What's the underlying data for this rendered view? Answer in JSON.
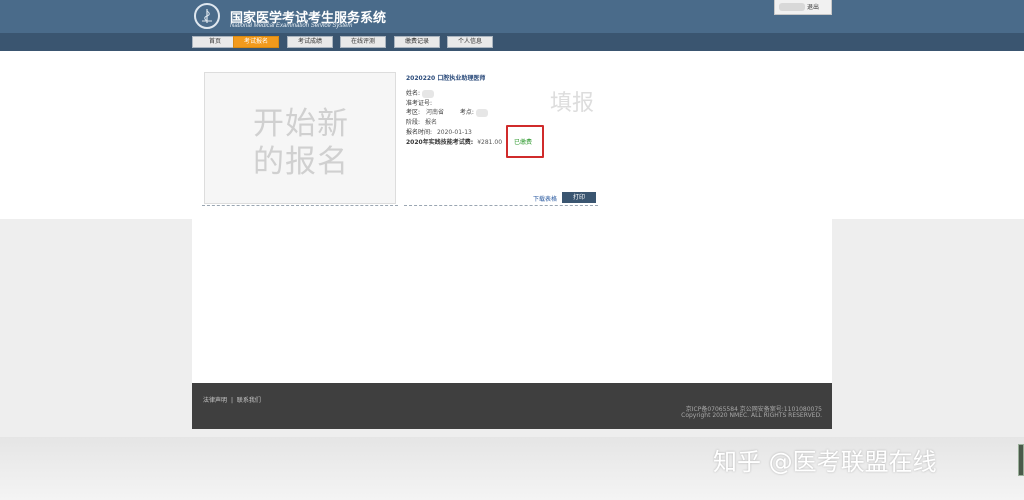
{
  "header": {
    "title": "国家医学考试考生服务系统",
    "subtitle": "National Medical Examination Service System",
    "logout_label": "退出",
    "brand_color": "#4a6b8a"
  },
  "nav": {
    "tabs": [
      {
        "label": "首页",
        "active": false
      },
      {
        "label": "考试报名",
        "active": true
      },
      {
        "label": "考试成绩",
        "active": false
      },
      {
        "label": "在线评测",
        "active": false
      },
      {
        "label": "缴费记录",
        "active": false
      },
      {
        "label": "个人信息",
        "active": false
      }
    ],
    "active_color": "#f29a1c"
  },
  "new_registration": {
    "text_line1": "开始新",
    "text_line2": "的报名"
  },
  "registration": {
    "title": "2020220 口腔执业助理医师",
    "name_label": "姓名:",
    "ticket_label": "准考证号:",
    "exam_area_label": "考区:",
    "exam_area_value": "河南省",
    "exam_site_label": "考点:",
    "stage_label": "阶段:",
    "stage_value": "报名",
    "reg_time_label": "报名时间:",
    "reg_time_value": "2020-01-13",
    "fee_label": "2020年实践技能考试费:",
    "fee_value": "¥281.00",
    "paid_status": "已缴费",
    "fill_watermark": "填报",
    "download_label": "下载表格",
    "print_label": "打印"
  },
  "footer": {
    "link_legal": "法律声明",
    "separator": "|",
    "link_contact": "联系我们",
    "icp": "京ICP备07065584 京公网安备案号:1101080075",
    "copyright": "Copyright 2020 NMEC. ALL RIGHTS RESERVED."
  },
  "watermark": {
    "text": "知乎 @医考联盟在线"
  }
}
